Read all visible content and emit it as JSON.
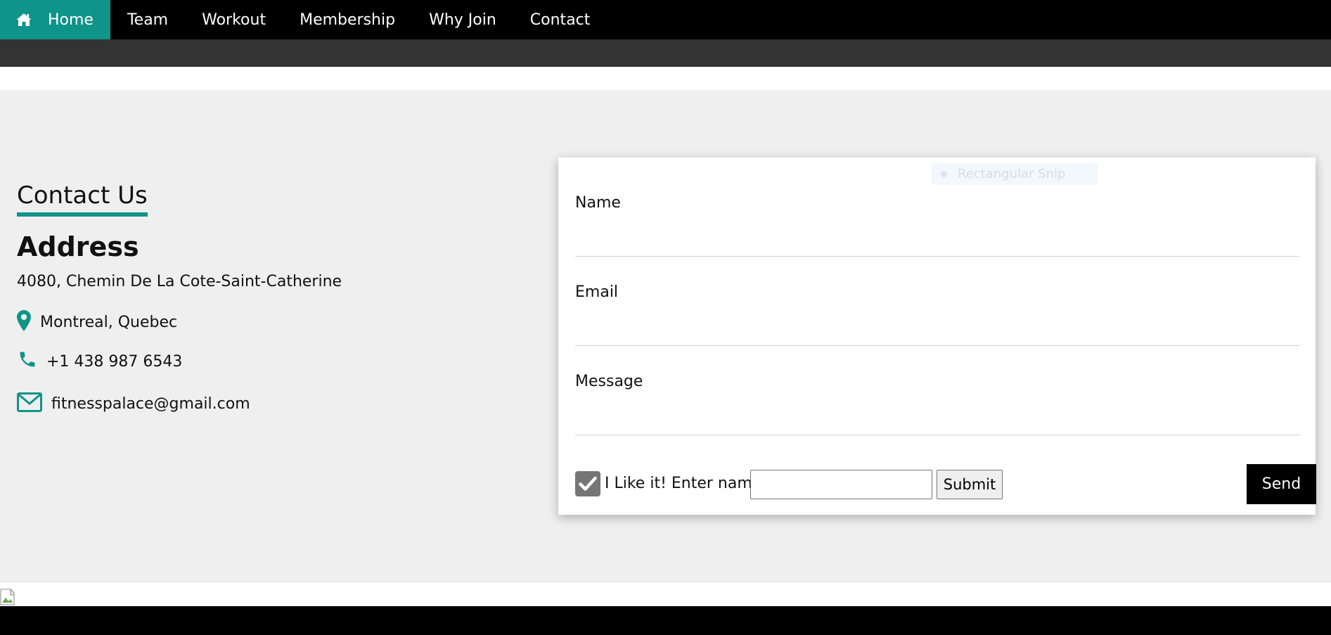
{
  "nav": {
    "items": [
      {
        "label": "Home",
        "active": true,
        "icon": "home-icon"
      },
      {
        "label": "Team",
        "active": false
      },
      {
        "label": "Workout",
        "active": false
      },
      {
        "label": "Membership",
        "active": false
      },
      {
        "label": "Why Join",
        "active": false
      },
      {
        "label": "Contact",
        "active": false
      }
    ]
  },
  "contact": {
    "heading": "Contact Us",
    "address_heading": "Address",
    "address_line": "4080, Chemin De La Cote-Saint-Catherine",
    "location": "Montreal, Quebec",
    "phone": "+1 438 987 6543",
    "email": "fitnesspalace@gmail.com",
    "icons": [
      "map-marker-icon",
      "phone-icon",
      "envelope-icon"
    ]
  },
  "form": {
    "snip_hint": "Rectangular Snip",
    "name_label": "Name",
    "name_value": "",
    "email_label": "Email",
    "email_value": "",
    "message_label": "Message",
    "message_value": "",
    "like_checked": true,
    "like_label": "I Like it! Enter name:",
    "like_name_value": "",
    "submit_label": "Submit",
    "send_label": "Send"
  },
  "colors": {
    "accent": "#0e9488",
    "nav_bg": "#000000",
    "subbar_bg": "#333333",
    "section_bg": "#efefef",
    "send_bg": "#000000"
  }
}
